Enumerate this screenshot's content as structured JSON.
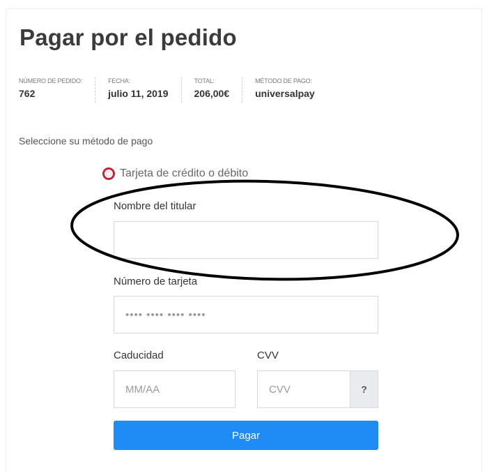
{
  "page": {
    "title": "Pagar por el pedido"
  },
  "order_details": [
    {
      "label": "NÚMERO DE PEDIDO:",
      "value": "762"
    },
    {
      "label": "FECHA:",
      "value": "julio 11, 2019"
    },
    {
      "label": "TOTAL:",
      "value": "206,00€"
    },
    {
      "label": "MÉTODO DE PAGO:",
      "value": "universalpay"
    }
  ],
  "payment": {
    "select_prompt": "Seleccione su método de pago",
    "method_label": "Tarjeta de crédito o débito",
    "method_selected": true,
    "accent_color": "#c0243a"
  },
  "form": {
    "holder_label": "Nombre del titular",
    "holder_value": "",
    "card_number_label": "Número de tarjeta",
    "card_number_placeholder": "•••• •••• •••• ••••",
    "expiry_label": "Caducidad",
    "expiry_placeholder": "MM/AA",
    "cvv_label": "CVV",
    "cvv_placeholder": "CVV",
    "cvv_help": "?",
    "submit_label": "Pagar",
    "button_color": "#1f8bf5"
  },
  "annotation": {
    "shape": "ellipse",
    "target": "holder-name-input",
    "color": "#000000"
  }
}
